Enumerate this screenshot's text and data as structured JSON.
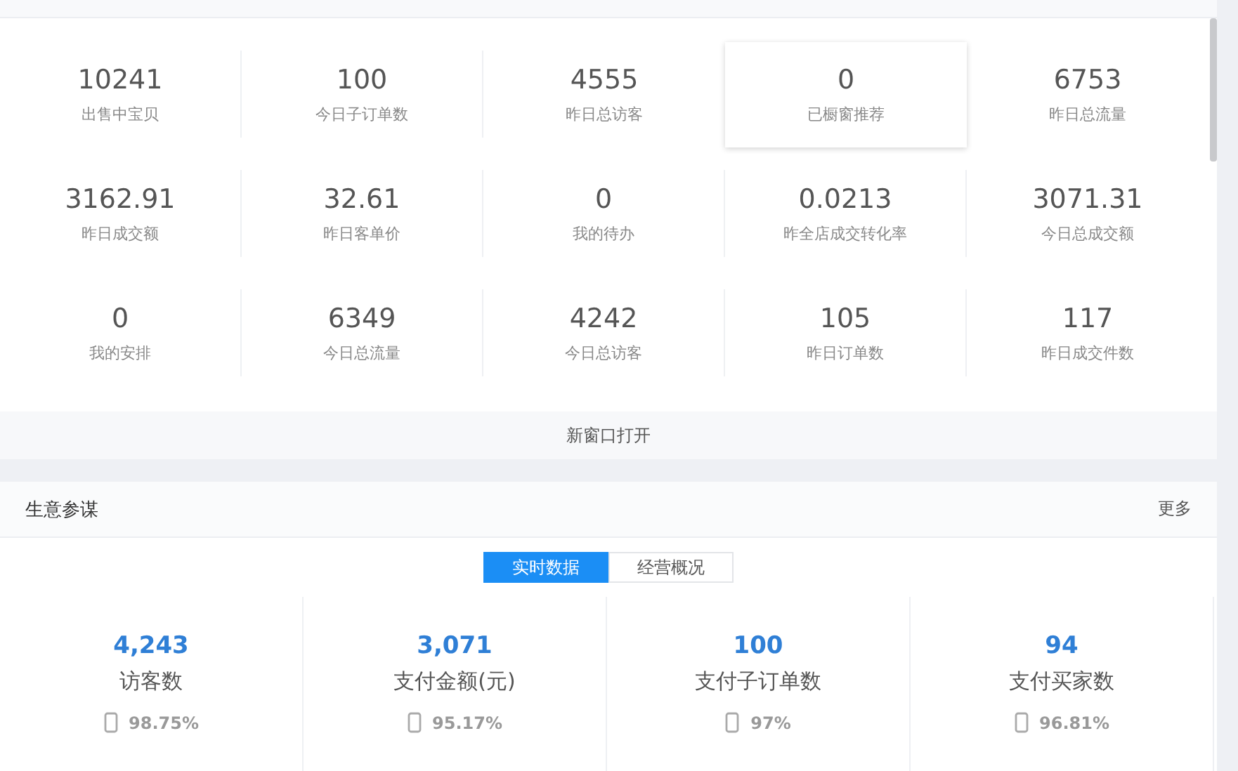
{
  "stats": [
    {
      "value": "10241",
      "label": "出售中宝贝",
      "highlighted": false
    },
    {
      "value": "100",
      "label": "今日子订单数",
      "highlighted": false
    },
    {
      "value": "4555",
      "label": "昨日总访客",
      "highlighted": false
    },
    {
      "value": "0",
      "label": "已橱窗推荐",
      "highlighted": true
    },
    {
      "value": "6753",
      "label": "昨日总流量",
      "highlighted": false
    },
    {
      "value": "3162.91",
      "label": "昨日成交额",
      "highlighted": false
    },
    {
      "value": "32.61",
      "label": "昨日客单价",
      "highlighted": false
    },
    {
      "value": "0",
      "label": "我的待办",
      "highlighted": false
    },
    {
      "value": "0.0213",
      "label": "昨全店成交转化率",
      "highlighted": false
    },
    {
      "value": "3071.31",
      "label": "今日总成交额",
      "highlighted": false
    },
    {
      "value": "0",
      "label": "我的安排",
      "highlighted": false
    },
    {
      "value": "6349",
      "label": "今日总流量",
      "highlighted": false
    },
    {
      "value": "4242",
      "label": "今日总访客",
      "highlighted": false
    },
    {
      "value": "105",
      "label": "昨日订单数",
      "highlighted": false
    },
    {
      "value": "117",
      "label": "昨日成交件数",
      "highlighted": false
    }
  ],
  "open_link": "新窗口打开",
  "section": {
    "title": "生意参谋",
    "more": "更多"
  },
  "tabs": [
    {
      "label": "实时数据",
      "selected": true
    },
    {
      "label": "经营概况",
      "selected": false
    }
  ],
  "metrics": [
    {
      "value": "4,243",
      "label": "访客数",
      "mobile_share": "98.75%"
    },
    {
      "value": "3,071",
      "label": "支付金额(元)",
      "mobile_share": "95.17%"
    },
    {
      "value": "100",
      "label": "支付子订单数",
      "mobile_share": "97%"
    },
    {
      "value": "94",
      "label": "支付买家数",
      "mobile_share": "96.81%"
    }
  ]
}
